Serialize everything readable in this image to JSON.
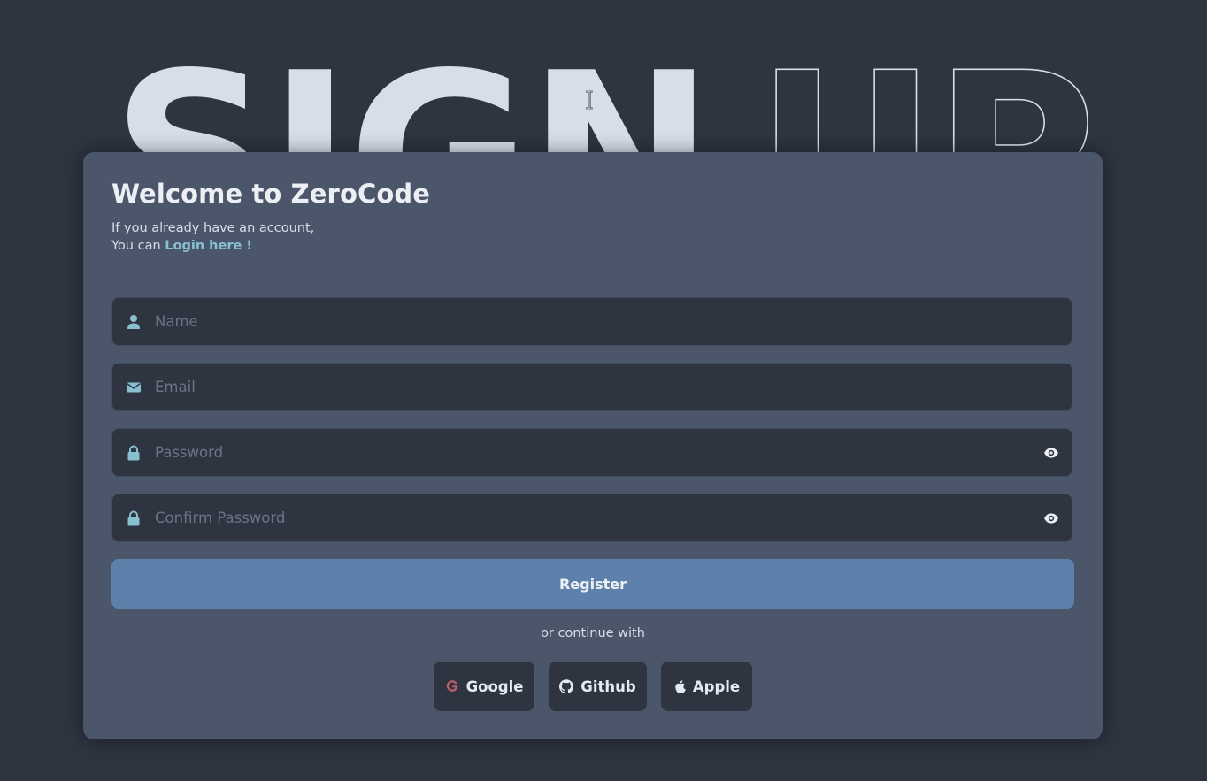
{
  "hero": {
    "word_solid": "SIGN",
    "word_outline": "UP"
  },
  "card": {
    "title": "Welcome to ZeroCode",
    "subtitle_line1": "If you already have an account,",
    "subtitle_line2_prefix": "You can ",
    "login_link": "Login here !"
  },
  "form": {
    "name_placeholder": "Name",
    "email_placeholder": "Email",
    "password_placeholder": "Password",
    "confirm_placeholder": "Confirm Password",
    "register_label": "Register"
  },
  "social": {
    "divider_text": "or continue with",
    "buttons": [
      {
        "label": "Google",
        "icon": "google-icon"
      },
      {
        "label": "Github",
        "icon": "github-icon"
      },
      {
        "label": "Apple",
        "icon": "apple-icon"
      }
    ]
  },
  "colors": {
    "page_bg": "#2e3440",
    "card_bg": "#4c566a",
    "input_bg": "#2e3440",
    "accent": "#5e81ac",
    "link": "#88c0d0",
    "google_red": "#bf616a"
  }
}
